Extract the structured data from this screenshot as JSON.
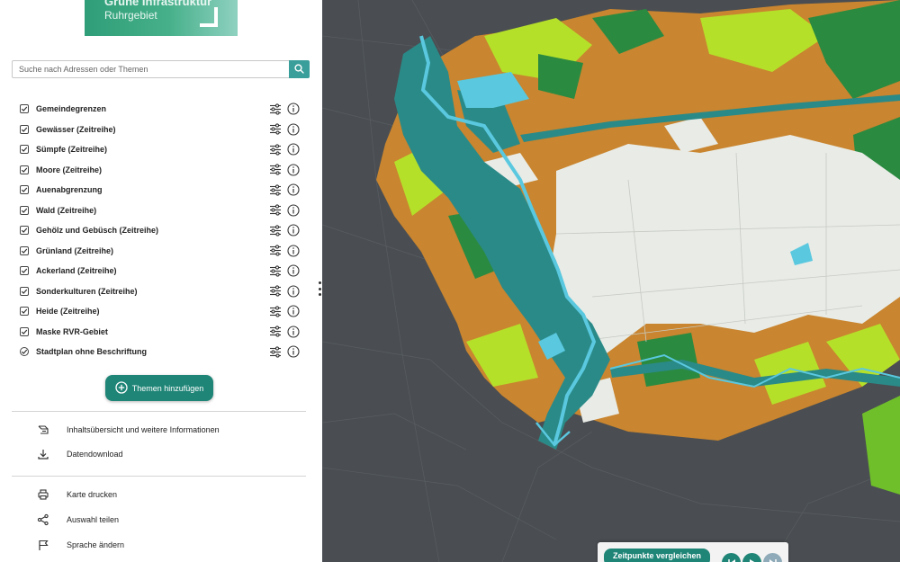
{
  "logo": {
    "line1": "Grüne Infrastruktur",
    "line2": "Ruhrgebiet"
  },
  "search": {
    "placeholder": "Suche nach Adressen oder Themen",
    "button_icon": "search-icon"
  },
  "layers": [
    {
      "label": "Gemeindegrenzen",
      "control": "checkbox",
      "checked": true
    },
    {
      "label": "Gewässer (Zeitreihe)",
      "control": "checkbox",
      "checked": true
    },
    {
      "label": "Sümpfe (Zeitreihe)",
      "control": "checkbox",
      "checked": true
    },
    {
      "label": "Moore (Zeitreihe)",
      "control": "checkbox",
      "checked": true
    },
    {
      "label": "Auenabgrenzung",
      "control": "checkbox",
      "checked": true
    },
    {
      "label": "Wald (Zeitreihe)",
      "control": "checkbox",
      "checked": true
    },
    {
      "label": "Gehölz und Gebüsch (Zeitreihe)",
      "control": "checkbox",
      "checked": true
    },
    {
      "label": "Grünland (Zeitreihe)",
      "control": "checkbox",
      "checked": true
    },
    {
      "label": "Ackerland (Zeitreihe)",
      "control": "checkbox",
      "checked": true
    },
    {
      "label": "Sonderkulturen (Zeitreihe)",
      "control": "checkbox",
      "checked": true
    },
    {
      "label": "Heide (Zeitreihe)",
      "control": "checkbox",
      "checked": true
    },
    {
      "label": "Maske RVR-Gebiet",
      "control": "checkbox",
      "checked": true
    },
    {
      "label": "Stadtplan ohne Beschriftung",
      "control": "radio",
      "checked": true
    }
  ],
  "layer_tools": {
    "settings_icon": "sliders-icon",
    "info_icon": "info-icon"
  },
  "add_themes": {
    "label": "Themen hinzufügen",
    "icon": "plus-circle-icon"
  },
  "menu": {
    "contents": {
      "label": "Inhaltsübersicht und weitere Informationen",
      "icon": "contents-icon"
    },
    "download": {
      "label": "Datendownload",
      "icon": "download-icon"
    },
    "print": {
      "label": "Karte drucken",
      "icon": "printer-icon"
    },
    "share": {
      "label": "Auswahl teilen",
      "icon": "share-icon"
    },
    "language": {
      "label": "Sprache ändern",
      "icon": "flag-icon"
    }
  },
  "time_panel": {
    "compare_label": "Zeitpunkte vergleichen",
    "buttons": [
      "skip-back-icon",
      "play-icon",
      "skip-forward-icon"
    ]
  },
  "colors": {
    "accent": "#1f8577",
    "search_button": "#3a9e9a",
    "map_background": "#4a4e52",
    "water": "#5ac8df",
    "floodplain": "#2a8a88",
    "forest": "#2a8a40",
    "grassland": "#b5e02a",
    "farmland": "#c9852f",
    "urban": "#e8ebe6"
  }
}
